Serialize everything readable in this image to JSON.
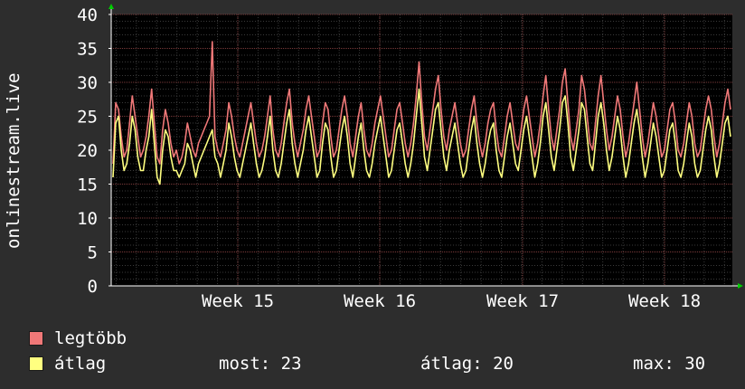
{
  "chart_data": {
    "type": "line",
    "ylabel": "onlinestream.live",
    "ylim": [
      0,
      40
    ],
    "yticks": [
      0,
      5,
      10,
      15,
      20,
      25,
      30,
      35,
      40
    ],
    "xtick_labels": [
      "Week 15",
      "Week 16",
      "Week 17",
      "Week 18"
    ],
    "grid": true,
    "series": [
      {
        "name": "legtöbb",
        "color": "#f07878",
        "values": [
          18,
          27,
          26,
          22,
          19,
          20,
          24,
          28,
          25,
          22,
          19,
          20,
          22,
          25,
          29,
          24,
          19,
          18,
          23,
          26,
          24,
          21,
          19,
          20,
          18,
          19,
          21,
          24,
          22,
          20,
          19,
          21,
          22,
          23,
          24,
          25,
          36,
          22,
          20,
          19,
          21,
          23,
          27,
          25,
          22,
          20,
          19,
          21,
          23,
          25,
          27,
          24,
          21,
          19,
          20,
          22,
          25,
          28,
          23,
          20,
          19,
          21,
          24,
          27,
          29,
          24,
          21,
          19,
          21,
          23,
          26,
          28,
          25,
          22,
          19,
          20,
          24,
          27,
          26,
          22,
          19,
          20,
          23,
          26,
          28,
          25,
          21,
          19,
          22,
          25,
          27,
          23,
          20,
          19,
          21,
          24,
          26,
          28,
          25,
          22,
          19,
          20,
          23,
          26,
          27,
          24,
          21,
          19,
          21,
          24,
          28,
          33,
          27,
          22,
          20,
          23,
          26,
          29,
          31,
          26,
          22,
          20,
          23,
          25,
          27,
          24,
          21,
          19,
          20,
          23,
          26,
          28,
          24,
          21,
          19,
          21,
          24,
          26,
          27,
          23,
          20,
          19,
          22,
          25,
          27,
          24,
          21,
          20,
          23,
          26,
          28,
          25,
          22,
          19,
          21,
          24,
          28,
          31,
          26,
          22,
          20,
          23,
          26,
          30,
          32,
          27,
          22,
          20,
          23,
          26,
          31,
          29,
          25,
          21,
          20,
          24,
          28,
          31,
          27,
          23,
          20,
          22,
          25,
          28,
          26,
          22,
          19,
          21,
          24,
          27,
          30,
          26,
          22,
          19,
          21,
          24,
          27,
          25,
          22,
          19,
          20,
          23,
          26,
          27,
          24,
          20,
          19,
          21,
          24,
          27,
          25,
          21,
          19,
          20,
          23,
          26,
          28,
          26,
          22,
          19,
          21,
          24,
          27,
          29,
          26
        ]
      },
      {
        "name": "átlag",
        "color": "#ffff80",
        "values": [
          16,
          24,
          25,
          20,
          17,
          18,
          21,
          25,
          23,
          19,
          17,
          17,
          20,
          22,
          26,
          21,
          16,
          15,
          20,
          23,
          22,
          19,
          17,
          17,
          16,
          17,
          18,
          21,
          20,
          18,
          16,
          18,
          19,
          20,
          21,
          22,
          23,
          19,
          18,
          16,
          18,
          20,
          24,
          22,
          19,
          17,
          16,
          18,
          20,
          22,
          24,
          21,
          18,
          16,
          17,
          19,
          22,
          25,
          20,
          17,
          16,
          18,
          21,
          24,
          26,
          21,
          18,
          16,
          18,
          20,
          23,
          25,
          22,
          19,
          16,
          17,
          21,
          24,
          23,
          19,
          16,
          17,
          20,
          23,
          25,
          22,
          18,
          16,
          19,
          22,
          24,
          20,
          17,
          16,
          18,
          21,
          23,
          25,
          22,
          19,
          16,
          17,
          20,
          23,
          24,
          21,
          18,
          16,
          18,
          21,
          25,
          29,
          24,
          19,
          17,
          20,
          23,
          26,
          27,
          23,
          19,
          17,
          20,
          22,
          24,
          21,
          18,
          16,
          17,
          20,
          23,
          25,
          21,
          18,
          16,
          18,
          21,
          23,
          24,
          20,
          17,
          16,
          19,
          22,
          24,
          21,
          18,
          17,
          20,
          23,
          25,
          22,
          19,
          16,
          18,
          21,
          25,
          27,
          23,
          19,
          17,
          20,
          23,
          27,
          28,
          24,
          19,
          17,
          20,
          23,
          27,
          26,
          22,
          18,
          17,
          21,
          25,
          27,
          24,
          20,
          17,
          19,
          22,
          25,
          23,
          19,
          16,
          18,
          21,
          24,
          26,
          23,
          19,
          16,
          18,
          21,
          24,
          22,
          19,
          16,
          17,
          20,
          23,
          24,
          21,
          17,
          16,
          18,
          21,
          24,
          22,
          18,
          16,
          17,
          20,
          23,
          25,
          23,
          19,
          16,
          18,
          21,
          24,
          25,
          22
        ]
      }
    ]
  },
  "legend": {
    "items": [
      {
        "label": "legtöbb",
        "color": "#f07878"
      },
      {
        "label": "átlag",
        "color": "#ffff80"
      }
    ],
    "stats": {
      "now": "most: 23",
      "avg": "átlag: 20",
      "max": "max: 30"
    }
  }
}
